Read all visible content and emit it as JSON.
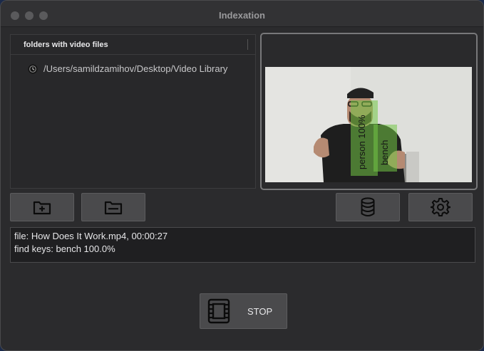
{
  "window": {
    "title": "Indexation"
  },
  "folders": {
    "header": "folders with video files",
    "items": [
      {
        "path": "/Users/samildzamihov/Desktop/Video Library"
      }
    ]
  },
  "preview": {
    "detections": [
      {
        "label": "person 100%"
      },
      {
        "label": "bench"
      }
    ]
  },
  "toolbar": {
    "add_folder_icon": "folder-plus-icon",
    "remove_folder_icon": "folder-minus-icon",
    "database_icon": "database-icon",
    "settings_icon": "gear-icon"
  },
  "info": {
    "line1": "file: How Does It Work.mp4, 00:00:27",
    "line2": "find keys: bench 100.0%"
  },
  "stop_button": {
    "label": "STOP",
    "icon": "film-icon"
  }
}
